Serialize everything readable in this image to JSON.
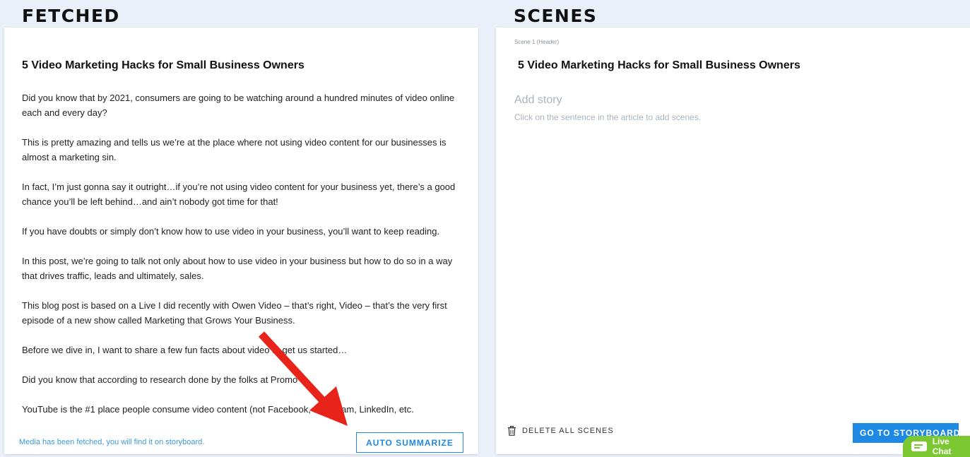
{
  "sections": {
    "fetched_title": "FETCHED",
    "scenes_title": "SCENES"
  },
  "article": {
    "title": "5 Video Marketing Hacks for Small Business Owners",
    "paragraphs": [
      "Did you know that by 2021, consumers are going to be watching around a hundred minutes of video online each and every day?",
      "This is pretty amazing and tells us we’re at the place where not using video content for our businesses is almost a marketing sin.",
      "In fact, I’m just gonna say it outright…if you’re not using video content for your business yet, there’s a good chance you’ll be left behind…and ain’t nobody got time for that!",
      "If you have doubts or simply don’t know how to use video in your business, you’ll want to keep reading.",
      "In this post, we’re going to talk not only about how to use video in your business but how to do so in a way that drives traffic, leads and ultimately, sales.",
      "This blog post is based on a Live I did recently with Owen Video – that’s right, Video – that’s the very first episode of a new show called Marketing that Grows Your Business.",
      "Before we dive in, I want to share a few fun facts about video to get us started…",
      "Did you know that according to research done by the folks at Promo",
      "YouTube is the #1 place people consume video content (not Facebook, Instagram, LinkedIn, etc."
    ],
    "status": "Media has been fetched, you will find it on storyboard.",
    "auto_summarize_label": "AUTO SUMMARIZE"
  },
  "scenes": {
    "scene_label": "Scene 1 (Header)",
    "scene_header": "5 Video Marketing Hacks for Small Business Owners",
    "add_story_placeholder": "Add story",
    "add_hint": "Click on the sentence in the article to add scenes.",
    "delete_all_label": "DELETE ALL SCENES",
    "go_storyboard_label": "GO TO STORYBOARD"
  },
  "live_chat": {
    "label": "Live Chat"
  },
  "colors": {
    "accent": "#1e88e5",
    "background": "#e9f0f9",
    "chat": "#7cc832",
    "annotation_arrow": "#e8231a"
  }
}
